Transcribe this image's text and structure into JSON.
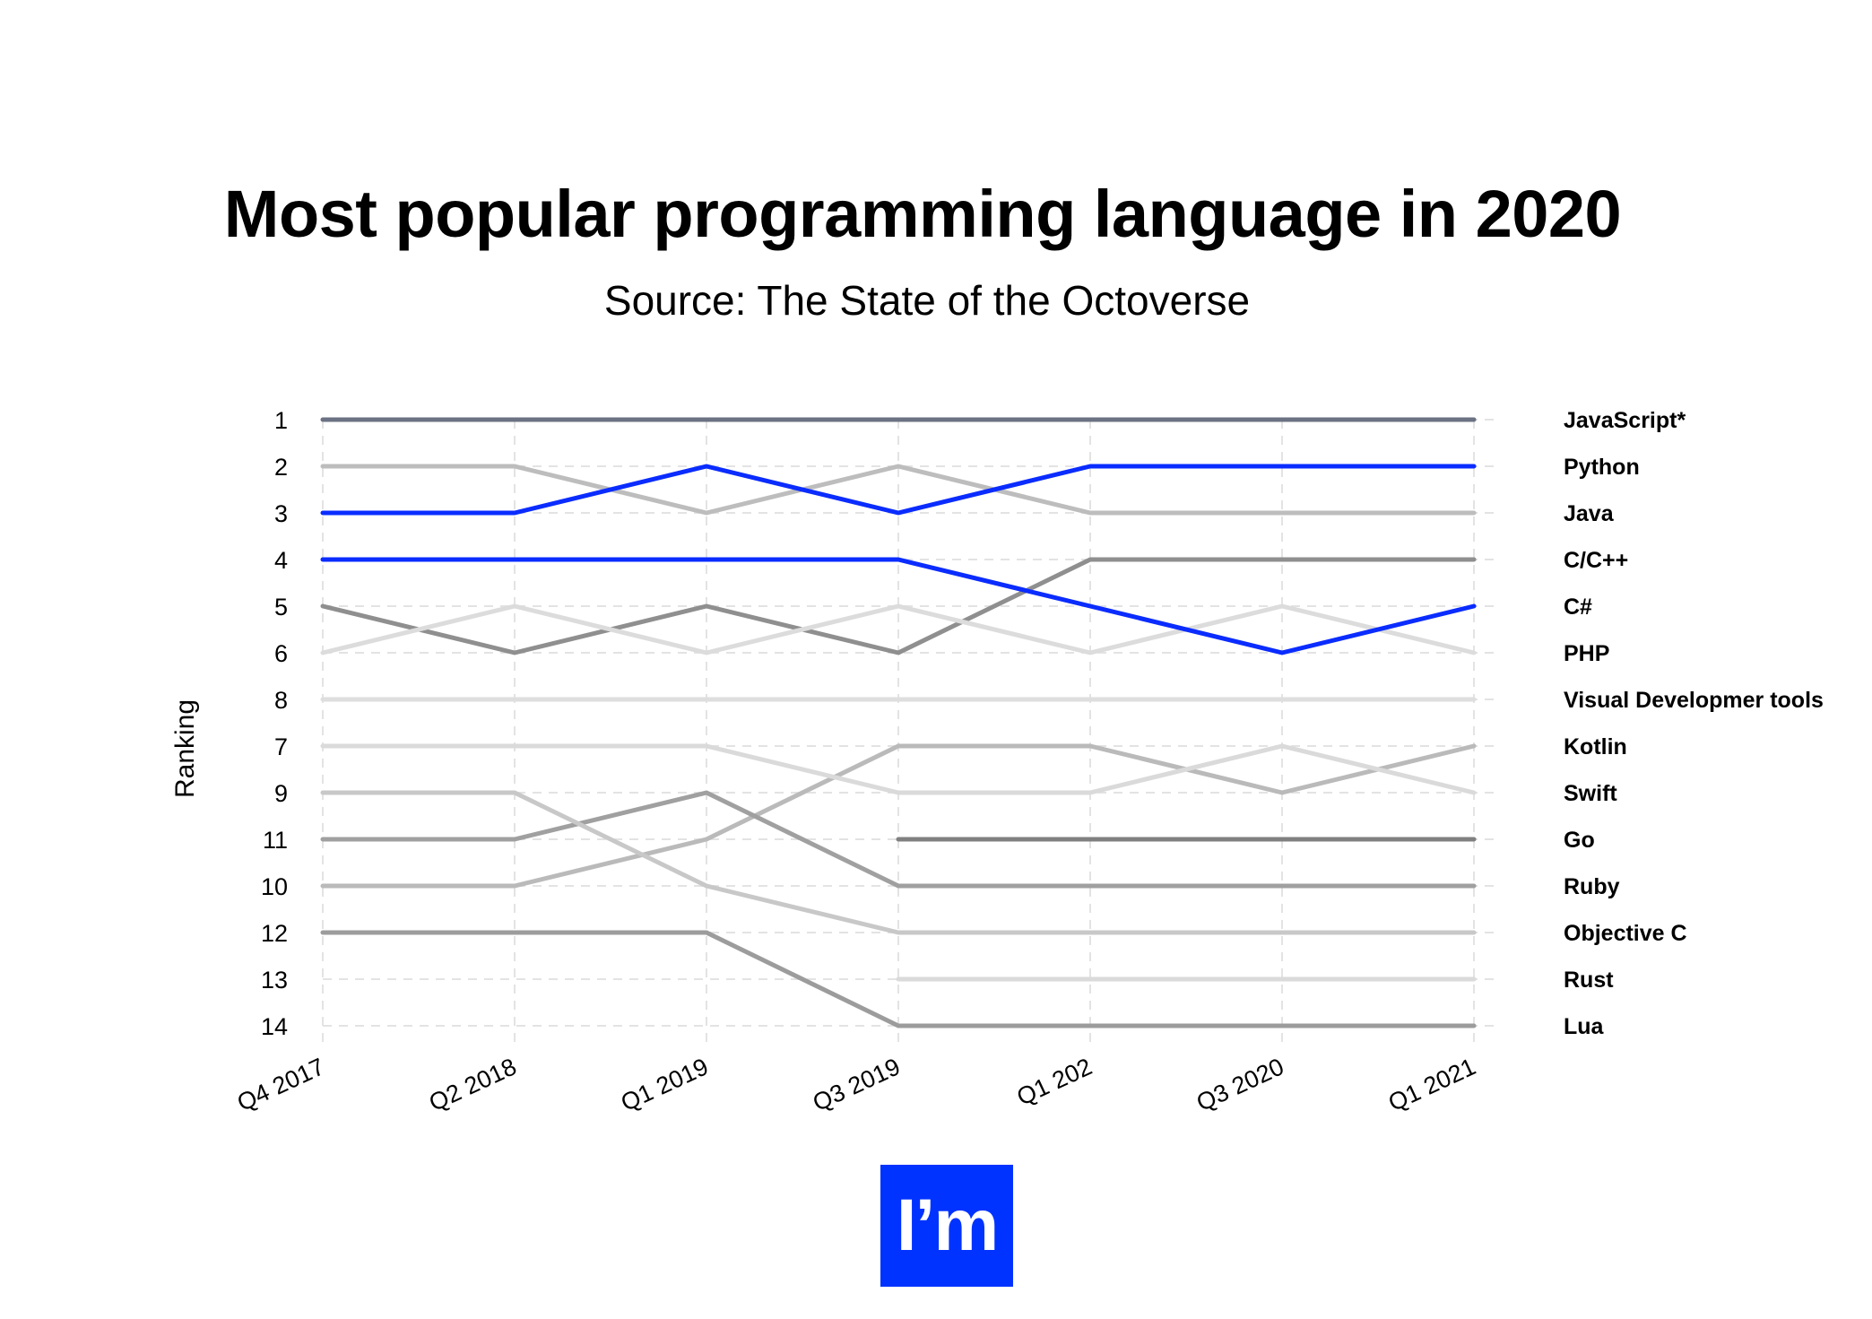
{
  "title": "Most popular programming language in 2020",
  "subtitle": "Source: The State of the Octoverse",
  "logo": {
    "text": "I’m",
    "color": "#0033ff"
  },
  "chart_data": {
    "type": "line",
    "title": "Most popular programming language in 2020",
    "subtitle": "Source: The State of the Octoverse",
    "xlabel": "",
    "ylabel": "Ranking",
    "x": [
      "Q4 2017",
      "Q2 2018",
      "Q1 2019",
      "Q3 2019",
      "Q1 202",
      "Q3 2020",
      "Q1 2021"
    ],
    "y_tick_labels": [
      "1",
      "2",
      "3",
      "4",
      "5",
      "6",
      "8",
      "7",
      "9",
      "11",
      "10",
      "12",
      "13",
      "14"
    ],
    "y_axis_note": "values are visual row positions (1 = top row); the printed tick label for each row is y_tick_labels[row-1]",
    "ylim": [
      1,
      14
    ],
    "y_inverted": true,
    "grid": true,
    "legend_placement": "right (labels at end of each line)",
    "series": [
      {
        "name": "JavaScript*",
        "color": "#6b7283",
        "values": [
          1,
          1,
          1,
          1,
          1,
          1,
          1
        ]
      },
      {
        "name": "Python",
        "color": "#0a2cff",
        "values": [
          3,
          3,
          2,
          3,
          2,
          2,
          2
        ]
      },
      {
        "name": "Java",
        "color": "#bdbdbd",
        "values": [
          2,
          2,
          3,
          2,
          3,
          3,
          3
        ]
      },
      {
        "name": "C/C++",
        "color": "#8f8f8f",
        "values": [
          5,
          6,
          5,
          6,
          4,
          4,
          4
        ]
      },
      {
        "name": "C#",
        "color": "#0a2cff",
        "values": [
          4,
          4,
          4,
          4,
          5,
          6,
          5
        ]
      },
      {
        "name": "PHP",
        "color": "#dcdcdc",
        "values": [
          6,
          5,
          6,
          5,
          6,
          5,
          6
        ]
      },
      {
        "name": "Visual Developmer tools",
        "color": "#dedede",
        "values": [
          7,
          7,
          7,
          7,
          7,
          7,
          7
        ]
      },
      {
        "name": "Kotlin",
        "color": "#bababa",
        "values": [
          11,
          11,
          10,
          8,
          8,
          9,
          8
        ]
      },
      {
        "name": "Swift",
        "color": "#dadada",
        "values": [
          8,
          8,
          8,
          9,
          9,
          8,
          9
        ]
      },
      {
        "name": "Go",
        "color": "#808080",
        "values": [
          null,
          null,
          null,
          10,
          10,
          10,
          10
        ]
      },
      {
        "name": "Ruby",
        "color": "#a0a0a0",
        "values": [
          10,
          10,
          9,
          11,
          11,
          11,
          11
        ]
      },
      {
        "name": "Objective C",
        "color": "#c8c8c8",
        "values": [
          9,
          9,
          11,
          12,
          12,
          12,
          12
        ]
      },
      {
        "name": "Rust",
        "color": "#dadada",
        "values": [
          null,
          null,
          null,
          13,
          13,
          13,
          13
        ]
      },
      {
        "name": "Lua",
        "color": "#9c9c9c",
        "values": [
          12,
          12,
          12,
          14,
          14,
          14,
          14
        ]
      }
    ],
    "legend": [
      "JavaScript*",
      "Python",
      "Java",
      "C/C++",
      "C#",
      "PHP",
      "Visual Developmer tools",
      "Kotlin",
      "Swift",
      "Go",
      "Ruby",
      "Objective C",
      "Rust",
      "Lua"
    ]
  }
}
